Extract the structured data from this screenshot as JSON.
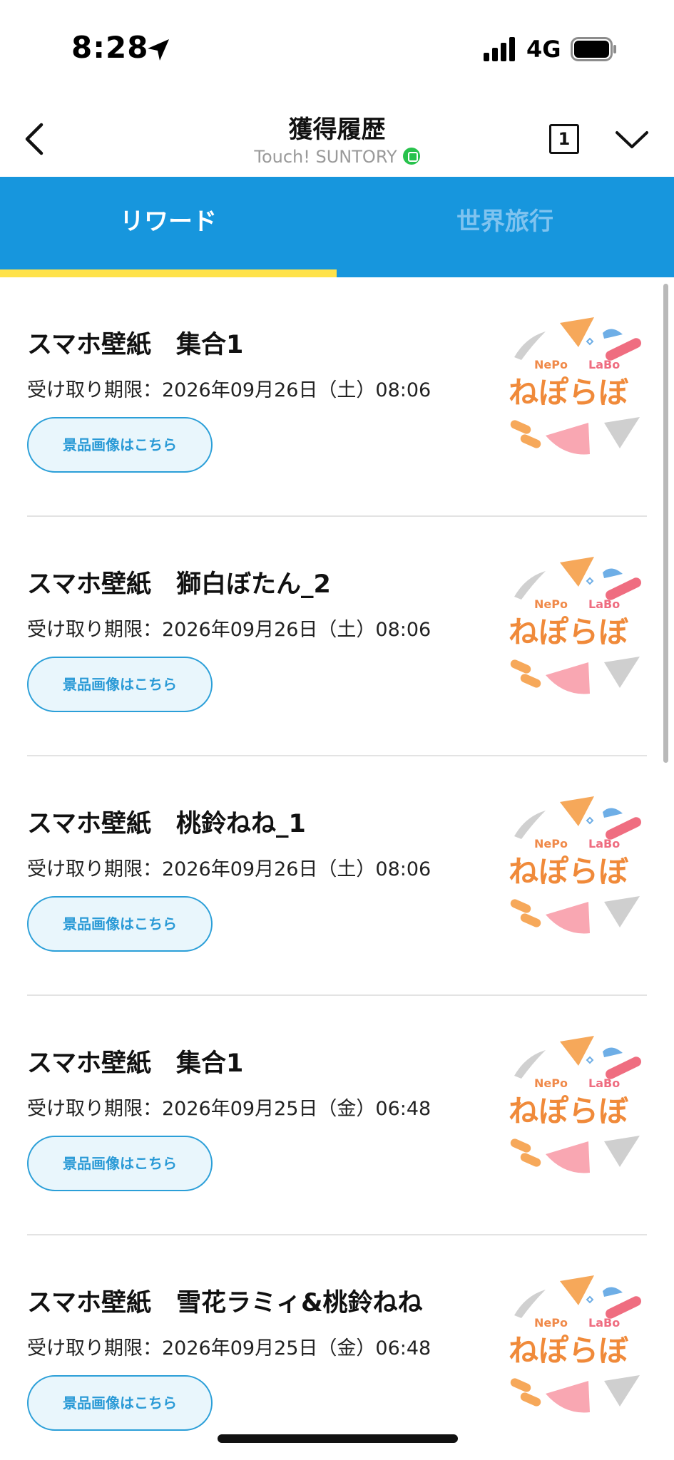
{
  "status_bar": {
    "time": "8:28",
    "network": "4G"
  },
  "header": {
    "title": "獲得履歴",
    "subtitle": "Touch! SUNTORY",
    "tab_count": "1"
  },
  "tabs": [
    {
      "label": "リワード",
      "active": true
    },
    {
      "label": "世界旅行",
      "active": false
    }
  ],
  "rewards": [
    {
      "title": "スマホ壁紙　集合1",
      "deadline": "受け取り期限：2026年09月26日（土）08:06",
      "button": "景品画像はこちら",
      "thumb_logo": "ねぽらぼ"
    },
    {
      "title": "スマホ壁紙　獅白ぼたん_2",
      "deadline": "受け取り期限：2026年09月26日（土）08:06",
      "button": "景品画像はこちら",
      "thumb_logo": "ねぽらぼ"
    },
    {
      "title": "スマホ壁紙　桃鈴ねね_1",
      "deadline": "受け取り期限：2026年09月26日（土）08:06",
      "button": "景品画像はこちら",
      "thumb_logo": "ねぽらぼ"
    },
    {
      "title": "スマホ壁紙　集合1",
      "deadline": "受け取り期限：2026年09月25日（金）06:48",
      "button": "景品画像はこちら",
      "thumb_logo": "ねぽらぼ"
    },
    {
      "title": "スマホ壁紙　雪花ラミィ&桃鈴ねね",
      "deadline": "受け取り期限：2026年09月25日（金）06:48",
      "button": "景品画像はこちら",
      "thumb_logo": "ねぽらぼ"
    }
  ],
  "colors": {
    "tab_bar": "#1796dd",
    "tab_indicator": "#ffe24a",
    "button_border": "#2b9fd8",
    "button_fill": "#e9f6fc"
  }
}
